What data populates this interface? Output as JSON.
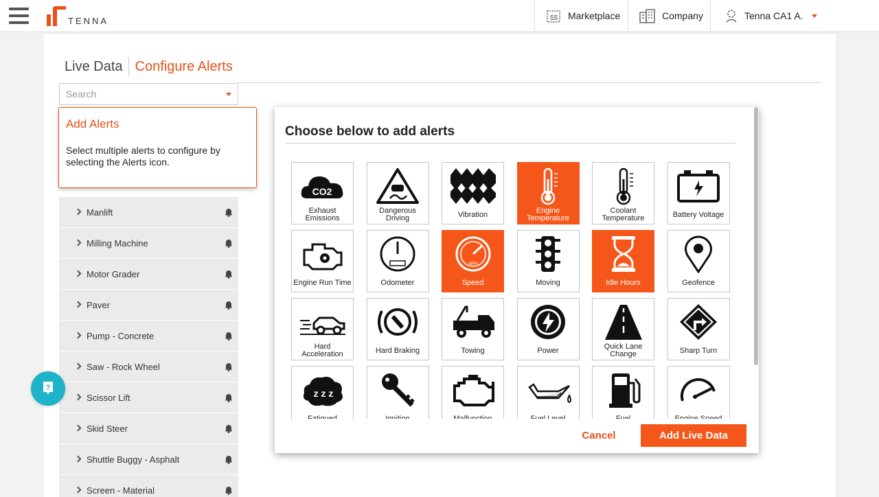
{
  "header": {
    "logo_text": "TENNA",
    "marketplace_label": "Marketplace",
    "company_label": "Company",
    "user_label": "Tenna CA1 A.",
    "accent": "#e8511a"
  },
  "tabs": {
    "live_label": "Live Data",
    "configure_label": "Configure Alerts"
  },
  "search": {
    "placeholder": "Search"
  },
  "tooltip": {
    "title": "Add Alerts",
    "body": "Select multiple alerts to configure by selecting the Alerts icon."
  },
  "list": {
    "items": [
      {
        "label": "Manlift"
      },
      {
        "label": "Milling Machine"
      },
      {
        "label": "Motor Grader"
      },
      {
        "label": "Paver"
      },
      {
        "label": "Pump - Concrete"
      },
      {
        "label": "Saw - Rock Wheel"
      },
      {
        "label": "Scissor Lift"
      },
      {
        "label": "Skid Steer"
      },
      {
        "label": "Shuttle Buggy - Asphalt"
      },
      {
        "label": "Screen - Material"
      }
    ]
  },
  "modal": {
    "title": "Choose below to add alerts",
    "cancel_label": "Cancel",
    "add_label": "Add Live Data",
    "tiles": [
      {
        "label": "Exhaust Emissions",
        "icon": "co2-cloud-icon",
        "selected": false
      },
      {
        "label": "Dangerous Driving",
        "icon": "slippery-road-icon",
        "selected": false
      },
      {
        "label": "Vibration",
        "icon": "vibration-icon",
        "selected": false
      },
      {
        "label": "Engine Temperature",
        "icon": "thermometer-icon",
        "selected": true
      },
      {
        "label": "Coolant Temperature",
        "icon": "coolant-thermometer-icon",
        "selected": false
      },
      {
        "label": "Battery Voltage",
        "icon": "battery-icon",
        "selected": false
      },
      {
        "label": "Engine Run Time",
        "icon": "engine-icon",
        "selected": false
      },
      {
        "label": "Odometer",
        "icon": "odometer-icon",
        "selected": false
      },
      {
        "label": "Speed",
        "icon": "speedometer-icon",
        "selected": true
      },
      {
        "label": "Moving",
        "icon": "traffic-light-icon",
        "selected": false
      },
      {
        "label": "Idle Hours",
        "icon": "hourglass-icon",
        "selected": true
      },
      {
        "label": "Geofence",
        "icon": "map-pin-icon",
        "selected": false
      },
      {
        "label": "Hard Acceleration",
        "icon": "car-acceleration-icon",
        "selected": false
      },
      {
        "label": "Hard Braking",
        "icon": "brake-icon",
        "selected": false
      },
      {
        "label": "Towing",
        "icon": "tow-truck-icon",
        "selected": false
      },
      {
        "label": "Power",
        "icon": "power-bolt-icon",
        "selected": false
      },
      {
        "label": "Quick Lane Change",
        "icon": "road-icon",
        "selected": false
      },
      {
        "label": "Sharp Turn",
        "icon": "turn-sign-icon",
        "selected": false
      },
      {
        "label": "Fatigued",
        "icon": "sleep-cloud-icon",
        "selected": false
      },
      {
        "label": "Ignition",
        "icon": "key-icon",
        "selected": false
      },
      {
        "label": "Malfunction",
        "icon": "check-engine-icon",
        "selected": false
      },
      {
        "label": "Fuel Level",
        "icon": "oil-can-icon",
        "selected": false
      },
      {
        "label": "Fuel",
        "icon": "fuel-pump-icon",
        "selected": false
      },
      {
        "label": "Engine Speed",
        "icon": "tachometer-icon",
        "selected": false
      }
    ]
  }
}
